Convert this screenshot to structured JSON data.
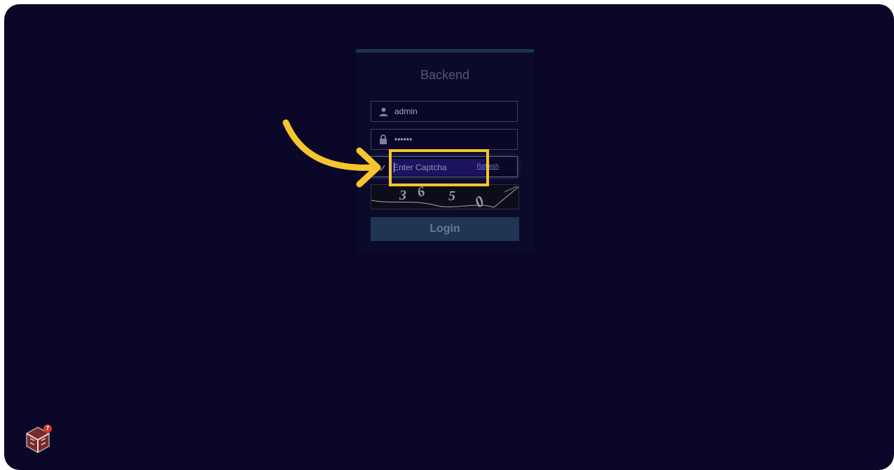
{
  "login": {
    "title": "Backend",
    "username_value": "admin",
    "password_mask": "••••••",
    "captcha_placeholder": "Enter Captcha",
    "refresh_label": "Refresh",
    "captcha_chars": [
      "3",
      "6",
      "5",
      "0"
    ],
    "login_label": "Login"
  },
  "overlay": {
    "badge_count": "7"
  },
  "colors": {
    "background": "#0b0729",
    "highlight": "#f7c52e",
    "login_button": "#1e3554"
  }
}
